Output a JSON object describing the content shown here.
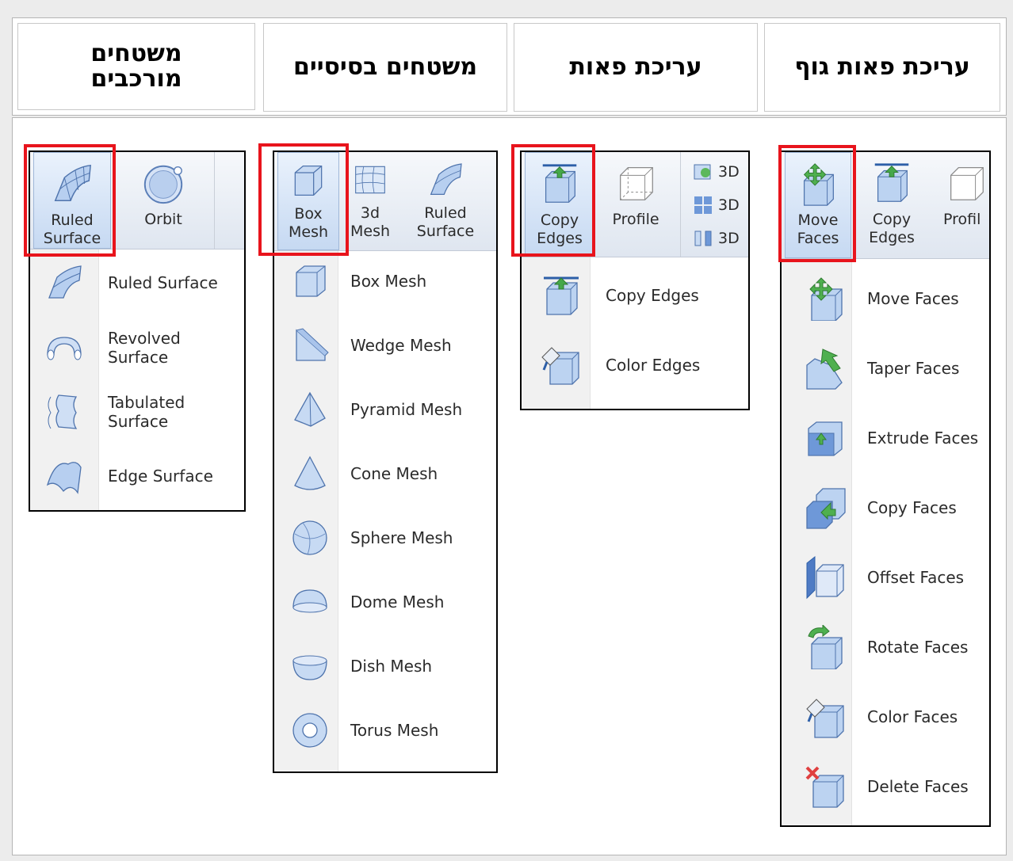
{
  "headers": [
    "עריכת פאות גוף",
    "עריכת פאות",
    "משטחים בסיסיים",
    "משטחים מורכבים"
  ],
  "panels": {
    "complex": {
      "ribbon": {
        "ruled_label": "Ruled\nSurface",
        "orbit_label": "Orbit"
      },
      "menu": [
        "Ruled Surface",
        "Revolved Surface",
        "Tabulated Surface",
        "Edge Surface"
      ]
    },
    "mesh": {
      "ribbon": {
        "box_label": "Box\nMesh",
        "mesh3d_label": "3d\nMesh",
        "ruled_label": "Ruled\nSurface"
      },
      "menu": [
        "Box Mesh",
        "Wedge Mesh",
        "Pyramid Mesh",
        "Cone Mesh",
        "Sphere Mesh",
        "Dome Mesh",
        "Dish Mesh",
        "Torus Mesh"
      ]
    },
    "edges": {
      "ribbon": {
        "copy_label": "Copy\nEdges",
        "profile_label": "Profile",
        "small_3d": [
          "3D",
          "3D",
          "3D"
        ]
      },
      "menu": [
        "Copy Edges",
        "Color Edges"
      ]
    },
    "faces": {
      "ribbon": {
        "move_label": "Move\nFaces",
        "copy_label": "Copy\nEdges",
        "profile_label": "Profil"
      },
      "menu": [
        "Move Faces",
        "Taper Faces",
        "Extrude Faces",
        "Copy Faces",
        "Offset Faces",
        "Rotate Faces",
        "Color Faces",
        "Delete Faces"
      ]
    }
  },
  "colors": {
    "highlight": "#e8141c",
    "icon_blue": "#8fb4e6"
  }
}
